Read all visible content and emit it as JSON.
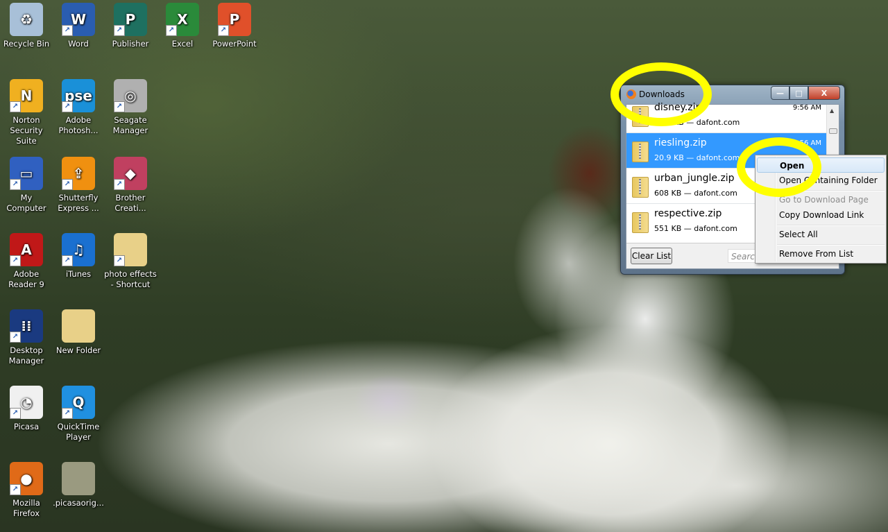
{
  "desktop": {
    "icons": [
      {
        "label": "Recycle Bin",
        "icon": "recycle-bin-icon",
        "color": "#a8c0d8",
        "glyph": "♻",
        "shortcut": false
      },
      {
        "label": "Word",
        "icon": "word-icon",
        "color": "#2a5db0",
        "glyph": "W",
        "shortcut": true
      },
      {
        "label": "Publisher",
        "icon": "publisher-icon",
        "color": "#1e7060",
        "glyph": "P",
        "shortcut": true
      },
      {
        "label": "Excel",
        "icon": "excel-icon",
        "color": "#2a8a3a",
        "glyph": "X",
        "shortcut": true
      },
      {
        "label": "PowerPoint",
        "icon": "powerpoint-icon",
        "color": "#e0502a",
        "glyph": "P",
        "shortcut": true
      },
      {
        "label": "Norton Security Suite",
        "icon": "norton-icon",
        "color": "#f0b020",
        "glyph": "N",
        "shortcut": true
      },
      {
        "label": "Adobe Photosh...",
        "icon": "photoshop-elements-icon",
        "color": "#1a90d8",
        "glyph": "pse",
        "shortcut": true
      },
      {
        "label": "Seagate Manager",
        "icon": "seagate-icon",
        "color": "#b0b0b0",
        "glyph": "◎",
        "shortcut": true
      },
      {
        "label": "My Computer",
        "icon": "computer-icon",
        "color": "#3060c0",
        "glyph": "▭",
        "shortcut": true
      },
      {
        "label": "Shutterfly Express ...",
        "icon": "shutterfly-icon",
        "color": "#f09010",
        "glyph": "⇪",
        "shortcut": true
      },
      {
        "label": "Brother Creati...",
        "icon": "brother-creative-icon",
        "color": "#c04060",
        "glyph": "◆",
        "shortcut": true
      },
      {
        "label": "Adobe Reader 9",
        "icon": "adobe-reader-icon",
        "color": "#c01818",
        "glyph": "A",
        "shortcut": true
      },
      {
        "label": "iTunes",
        "icon": "itunes-icon",
        "color": "#1a70d0",
        "glyph": "♫",
        "shortcut": true
      },
      {
        "label": "photo effects - Shortcut",
        "icon": "folder-icon",
        "color": "#e8d088",
        "glyph": "",
        "shortcut": true
      },
      {
        "label": "Desktop Manager",
        "icon": "blackberry-icon",
        "color": "#1a3a80",
        "glyph": "⁞⁞",
        "shortcut": true
      },
      {
        "label": "New Folder",
        "icon": "folder-icon",
        "color": "#e8d088",
        "glyph": "",
        "shortcut": false
      },
      {
        "label": "Picasa",
        "icon": "picasa-icon",
        "color": "#f0f0f0",
        "glyph": "◔",
        "shortcut": true
      },
      {
        "label": "QuickTime Player",
        "icon": "quicktime-icon",
        "color": "#2090e0",
        "glyph": "Q",
        "shortcut": true
      },
      {
        "label": "Mozilla Firefox",
        "icon": "firefox-icon",
        "color": "#e06a18",
        "glyph": "●",
        "shortcut": true
      },
      {
        "label": ".picasaorig...",
        "icon": "folder-icon",
        "color": "#9a9a80",
        "glyph": "",
        "shortcut": false
      }
    ]
  },
  "downloads_window": {
    "title": "Downloads",
    "buttons": {
      "minimize": "—",
      "maximize": "□",
      "close": "X"
    },
    "items": [
      {
        "name": "disney.zip",
        "meta": "65.4 KB — dafont.com",
        "time": "9:56 AM",
        "selected": false
      },
      {
        "name": "riesling.zip",
        "meta": "20.9 KB — dafont.com",
        "time": "9:56 AM",
        "selected": true
      },
      {
        "name": "urban_jungle.zip",
        "meta": "608 KB — dafont.com",
        "time": "",
        "selected": false
      },
      {
        "name": "respective.zip",
        "meta": "551 KB — dafont.com",
        "time": "",
        "selected": false
      }
    ],
    "clear_list_label": "Clear List",
    "search_placeholder": "Search..."
  },
  "context_menu": {
    "items": [
      {
        "label": "Open",
        "highlighted": true,
        "disabled": false
      },
      {
        "label": "Open Containing Folder",
        "highlighted": false,
        "disabled": false
      },
      {
        "label": "Go to Download Page",
        "highlighted": false,
        "disabled": true
      },
      {
        "label": "Copy Download Link",
        "highlighted": false,
        "disabled": false
      },
      {
        "label": "Select All",
        "highlighted": false,
        "disabled": false
      },
      {
        "label": "Remove From List",
        "highlighted": false,
        "disabled": false
      }
    ]
  },
  "annotations": {
    "highlight_color": "#ffff00"
  }
}
